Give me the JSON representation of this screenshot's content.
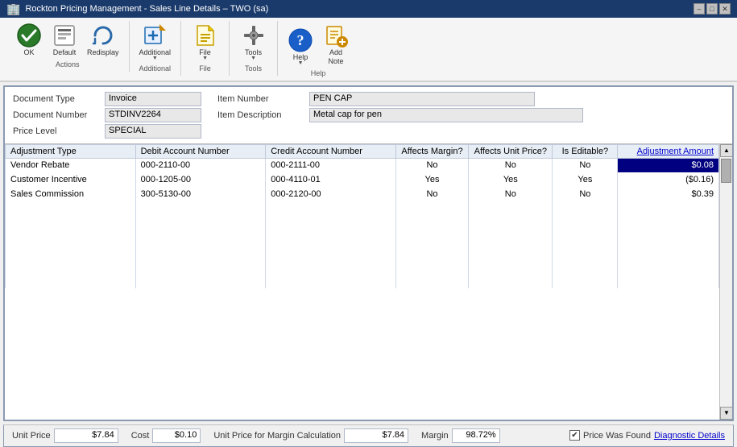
{
  "titleBar": {
    "appName": "Rockton Pricing Management",
    "windowTitle": "Sales Line Details",
    "user": "TWO (sa)"
  },
  "ribbon": {
    "buttons": [
      {
        "id": "ok",
        "label": "OK",
        "icon": "✔",
        "iconClass": "icon-ok",
        "hasDropdown": false,
        "group": "Actions"
      },
      {
        "id": "default",
        "label": "Default",
        "icon": "🔲",
        "iconClass": "icon-default",
        "hasDropdown": false,
        "group": "Actions"
      },
      {
        "id": "redisplay",
        "label": "Redisplay",
        "icon": "↺",
        "iconClass": "icon-redisplay",
        "hasDropdown": false,
        "group": "Actions"
      }
    ],
    "groups": [
      {
        "id": "actions",
        "label": "Actions",
        "buttons": [
          "OK",
          "Default",
          "Redisplay"
        ]
      },
      {
        "id": "additional",
        "label": "Additional",
        "buttons": [
          "Additional"
        ]
      },
      {
        "id": "file",
        "label": "File",
        "buttons": [
          "File"
        ]
      },
      {
        "id": "tools",
        "label": "Tools",
        "buttons": [
          "Tools"
        ]
      },
      {
        "id": "help",
        "label": "Help",
        "buttons": [
          "Help",
          "Add Note"
        ]
      }
    ]
  },
  "form": {
    "documentType": {
      "label": "Document Type",
      "value": "Invoice"
    },
    "documentNumber": {
      "label": "Document Number",
      "value": "STDINV2264"
    },
    "priceLevel": {
      "label": "Price Level",
      "value": "SPECIAL"
    },
    "itemNumber": {
      "label": "Item Number",
      "value": "PEN CAP"
    },
    "itemDescription": {
      "label": "Item Description",
      "value": "Metal cap for pen"
    }
  },
  "table": {
    "columns": [
      {
        "id": "adjType",
        "label": "Adjustment Type",
        "width": "18%"
      },
      {
        "id": "debitAcct",
        "label": "Debit Account Number",
        "width": "18%"
      },
      {
        "id": "creditAcct",
        "label": "Credit Account Number",
        "width": "18%"
      },
      {
        "id": "affectsMargin",
        "label": "Affects Margin?",
        "width": "9%",
        "align": "center"
      },
      {
        "id": "affectsUnitPrice",
        "label": "Affects Unit Price?",
        "width": "9%",
        "align": "center"
      },
      {
        "id": "isEditable",
        "label": "Is Editable?",
        "width": "9%",
        "align": "center"
      },
      {
        "id": "adjAmount",
        "label": "Adjustment Amount",
        "width": "14%",
        "align": "right",
        "isLink": true
      }
    ],
    "rows": [
      {
        "adjType": "Vendor Rebate",
        "debitAcct": "000-2110-00",
        "creditAcct": "000-2111-00",
        "affectsMargin": "No",
        "affectsUnitPrice": "No",
        "isEditable": "No",
        "adjAmount": "$0.08",
        "selected": true
      },
      {
        "adjType": "Customer Incentive",
        "debitAcct": "000-1205-00",
        "creditAcct": "000-4110-01",
        "affectsMargin": "Yes",
        "affectsUnitPrice": "Yes",
        "isEditable": "Yes",
        "adjAmount": "($0.16)",
        "selected": false
      },
      {
        "adjType": "Sales Commission",
        "debitAcct": "300-5130-00",
        "creditAcct": "000-2120-00",
        "affectsMargin": "No",
        "affectsUnitPrice": "No",
        "isEditable": "No",
        "adjAmount": "$0.39",
        "selected": false
      },
      {
        "adjType": "",
        "debitAcct": "",
        "creditAcct": "",
        "affectsMargin": "",
        "affectsUnitPrice": "",
        "isEditable": "",
        "adjAmount": "",
        "selected": false
      },
      {
        "adjType": "",
        "debitAcct": "",
        "creditAcct": "",
        "affectsMargin": "",
        "affectsUnitPrice": "",
        "isEditable": "",
        "adjAmount": "",
        "selected": false
      },
      {
        "adjType": "",
        "debitAcct": "",
        "creditAcct": "",
        "affectsMargin": "",
        "affectsUnitPrice": "",
        "isEditable": "",
        "adjAmount": "",
        "selected": false
      },
      {
        "adjType": "",
        "debitAcct": "",
        "creditAcct": "",
        "affectsMargin": "",
        "affectsUnitPrice": "",
        "isEditable": "",
        "adjAmount": "",
        "selected": false
      },
      {
        "adjType": "",
        "debitAcct": "",
        "creditAcct": "",
        "affectsMargin": "",
        "affectsUnitPrice": "",
        "isEditable": "",
        "adjAmount": "",
        "selected": false
      },
      {
        "adjType": "",
        "debitAcct": "",
        "creditAcct": "",
        "affectsMargin": "",
        "affectsUnitPrice": "",
        "isEditable": "",
        "adjAmount": "",
        "selected": false
      }
    ]
  },
  "statusBar": {
    "unitPrice": {
      "label": "Unit Price",
      "value": "$7.84"
    },
    "cost": {
      "label": "Cost",
      "value": "$0.10"
    },
    "unitPriceMargin": {
      "label": "Unit Price for Margin Calculation",
      "value": "$7.84"
    },
    "margin": {
      "label": "Margin",
      "value": "98.72%"
    },
    "priceWasFound": {
      "label": "Price Was Found",
      "checked": true
    },
    "diagnosticDetails": {
      "label": "Diagnostic Details"
    }
  }
}
